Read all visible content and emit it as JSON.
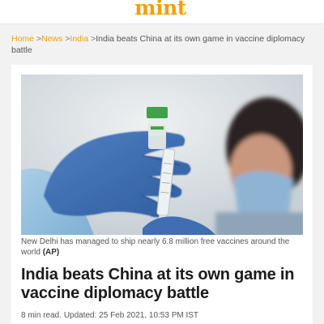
{
  "masthead": {
    "logo_text": "mint",
    "brand_color": "#f29f05"
  },
  "breadcrumb": {
    "items": [
      "Home",
      "News",
      "India"
    ],
    "separator": ">",
    "current": "India beats China at its own game in vaccine diplomacy battle"
  },
  "article": {
    "hero_image": {
      "caption_text": "New Delhi has managed to ship nearly 6.8 million free vaccines around the world",
      "caption_credit": "(AP)"
    },
    "headline": "India beats China at its own game in vaccine diplomacy battle",
    "read_time": "8 min read",
    "meta_separator": ". ",
    "updated_label": "Updated: 25 Feb 2021, 10:53 PM IST"
  }
}
